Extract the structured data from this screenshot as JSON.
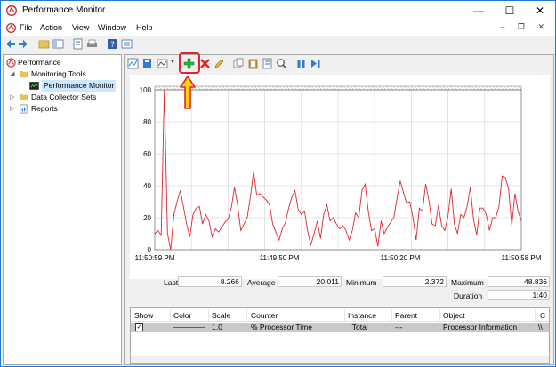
{
  "window": {
    "title": "Performance Monitor",
    "controls": {
      "minimize": "—",
      "maximize": "☐",
      "close": "✕"
    }
  },
  "menu": {
    "items": [
      "File",
      "Action",
      "View",
      "Window",
      "Help"
    ],
    "mdi_controls": "– ❐ ✕"
  },
  "tree": {
    "root": "Performance",
    "monitoring_tools": "Monitoring Tools",
    "performance_monitor": "Performance Monitor",
    "data_collector_sets": "Data Collector Sets",
    "reports": "Reports"
  },
  "chart_data": {
    "type": "line",
    "ylim": [
      0,
      100
    ],
    "yticks": [
      "100",
      "80",
      "60",
      "40",
      "20",
      "0"
    ],
    "xticks": [
      "11:50:59 PM",
      "11:49:50 PM",
      "11:50:20 PM",
      "11:50:58 PM"
    ],
    "series": [
      {
        "color": "#e0262e",
        "values": [
          10,
          12,
          9,
          100,
          10,
          0,
          22,
          30,
          37,
          27,
          16,
          8,
          22,
          26,
          27,
          16,
          22,
          18,
          8,
          13,
          11,
          14,
          17,
          19,
          26,
          39,
          28,
          12,
          16,
          20,
          33,
          49,
          34,
          35,
          33,
          31,
          28,
          16,
          11,
          6,
          13,
          17,
          26,
          33,
          37,
          25,
          22,
          24,
          11,
          3,
          10,
          18,
          7,
          22,
          28,
          18,
          20,
          16,
          13,
          15,
          12,
          6,
          12,
          23,
          20,
          37,
          41,
          24,
          12,
          13,
          2,
          18,
          10,
          14,
          17,
          20,
          32,
          43,
          36,
          29,
          30,
          20,
          6,
          26,
          24,
          41,
          31,
          16,
          15,
          28,
          15,
          12,
          21,
          38,
          16,
          10,
          22,
          20,
          27,
          39,
          19,
          9,
          26,
          26,
          22,
          12,
          20,
          20,
          27,
          46,
          45,
          38,
          15,
          35,
          24,
          18
        ]
      }
    ]
  },
  "stats": {
    "last_label": "Last",
    "last_value": "8.266",
    "average_label": "Average",
    "average_value": "20.011",
    "minimum_label": "Minimum",
    "minimum_value": "2.372",
    "maximum_label": "Maximum",
    "maximum_value": "48.836",
    "duration_label": "Duration",
    "duration_value": "1:40"
  },
  "legend": {
    "headers": [
      "Show",
      "Color",
      "Scale",
      "Counter",
      "Instance",
      "Parent",
      "Object",
      "C"
    ],
    "row": {
      "show": "✓",
      "scale": "1.0",
      "counter": "% Processor Time",
      "instance": "_Total",
      "parent": "---",
      "object": "Processor Information",
      "computer": "\\\\"
    }
  },
  "colors": {
    "accent": "#1b7ad6",
    "series": "#e0262e",
    "highlight": "#e0252f",
    "arrow": "#ffd400"
  }
}
